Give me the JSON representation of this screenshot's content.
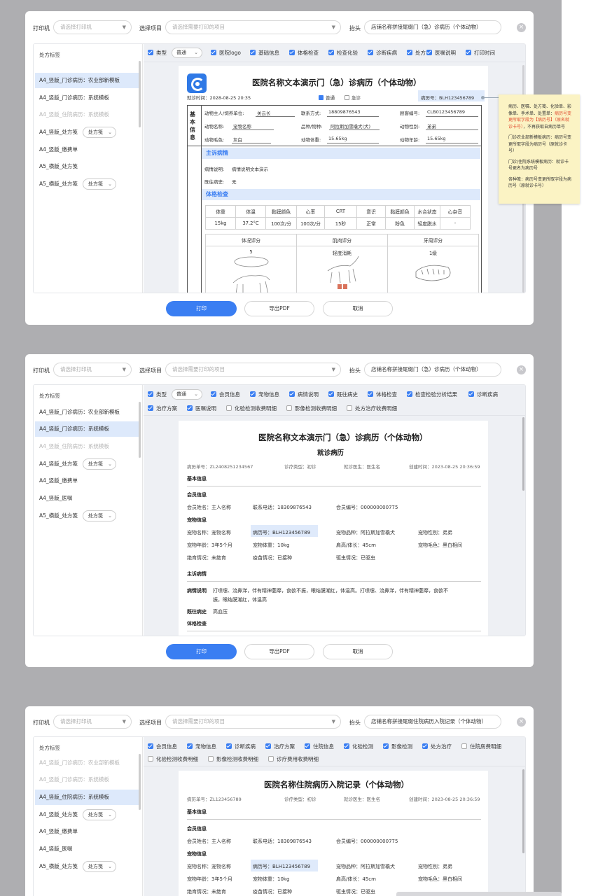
{
  "common": {
    "printer_label": "打印机",
    "printer_placeholder": "请选择打印机",
    "project_label": "选择项目",
    "project_placeholder": "请选择需要打印的项目",
    "header_label": "抬头",
    "side_title": "处方标签",
    "type_label": "类型",
    "type_value": "普通",
    "rx_value": "处方笺",
    "print_btn": "打印",
    "pdf_btn": "导出PDF",
    "cancel_btn": "取消",
    "close_icon": "×"
  },
  "panel1": {
    "header_value": "店铺名称拼接尾缀门（急）诊病历（个体动物）",
    "side_items": [
      "A4_竖版_门诊病历：农业部新模板",
      "A4_竖版_门诊病历：系统模板",
      "A4_竖版_住院病历：系统模板",
      "A4_竖版_处方笺",
      "A4_竖版_缴费单",
      "A5_横版_处方笺"
    ],
    "checks": [
      "医院logo",
      "基础信息",
      "体格检查",
      "检查化验",
      "诊断疾病",
      "处方",
      "医嘱说明",
      "打印时间"
    ],
    "doc": {
      "title": "医院名称文本演示门（急）诊病历（个体动物）",
      "visit_time": "就诊时间：2028-08-25 20:35",
      "normal": "普通",
      "emergency": "急诊",
      "record_no": "病历号：BLH123456789",
      "basic_label": "基本信息",
      "owner_label": "动物主人/饲养单位:",
      "owner": "关云长",
      "contact_label": "联系方式:",
      "contact": "18809876543",
      "client_label": "顾客编号:",
      "client": "CLB0123456789",
      "name_label": "动物名称:",
      "name": "宠物名称",
      "breed_label": "品种/物种:",
      "breed": "阿拉斯加雪橇犬(犬)",
      "sex_label": "动物性别:",
      "sex": "弟弟",
      "fur_label": "动物毛色:",
      "fur": "灰白",
      "weight_label": "动物体重:",
      "weight": "15.65kg",
      "age_label": "动物年龄:",
      "age": "15.65kg",
      "complaint_head": "主诉病情",
      "desc_label": "病情说明:",
      "desc": "病情说明文本演示",
      "history_label": "既往病史:",
      "history": "无",
      "exam_head": "体格检查",
      "exam_headers": [
        "体重",
        "体温",
        "黏膜颜色",
        "心率",
        "CRT",
        "意识",
        "黏膜颜色",
        "水合状态",
        "心杂音"
      ],
      "exam_values": [
        "15kg",
        "37.2°C",
        "100次/分",
        "100次/分",
        "15秒",
        "正常",
        "粉色",
        "轻度脱水",
        "-"
      ],
      "score_headers": [
        "体况评分",
        "肌肉评分",
        "牙周评分"
      ],
      "score_values": [
        "5",
        "轻度消耗",
        "1级"
      ]
    },
    "note": {
      "p1a": "病历、医嘱、处方笺、化验单、影像单、手术单、处置单：",
      "p1b": "病历号变更所取字段为【病历号】（原名就诊卡号）",
      "p1c": "，不再获取自病历单号",
      "p2": "门诊农业部新模板病历：病历号变更所取字段为病历号（原就诊卡号）",
      "p3": "门诊/住院系统模板病历：就诊卡号更名为病历号",
      "p4": "各种笺：病历号变更所取字段为病历号（原就诊卡号）"
    }
  },
  "panel2": {
    "header_value": "店铺名称拼接尾缀门（急）诊病历（个体动物）",
    "side_items": [
      "A4_竖版_门诊病历：农业部新模板",
      "A4_竖版_门诊病历：系统模板",
      "A4_竖版_住院病历：系统模板",
      "A4_竖版_处方笺",
      "A4_竖版_缴费单",
      "A4_竖版_医嘱",
      "A5_横版_处方笺"
    ],
    "checks_row1": [
      "会员信息",
      "宠物信息",
      "病情说明",
      "既往病史",
      "体格检查",
      "检查检验分析结果",
      "诊断疾病"
    ],
    "checks_row2_on": [
      "治疗方案",
      "医嘱说明"
    ],
    "checks_row2_off": [
      "化验检测收费明细",
      "影像检测收费明细",
      "处方治疗收费明细"
    ],
    "doc": {
      "title": "医院名称文本演示门（急）诊病历（个体动物）",
      "subtitle": "就诊病历",
      "record": "病历单号：ZL2408251234567",
      "visit_type": "诊疗类型：初诊",
      "doctor": "就诊医生：医生名",
      "created": "创建时间：2023-08-25 20:36:59",
      "basic": "基本信息",
      "member": "会员信息",
      "member_name": "会员姓名：主人名称",
      "phone": "联系电话：18309876543",
      "member_no": "会员编号：000000000775",
      "pet": "宠物信息",
      "pet_name": "宠物名称：宠物名称",
      "record_no": "病历号：BLH123456789",
      "breed": "宠物品种：阿拉斯加雪橇犬",
      "sex": "宠物性别：弟弟",
      "age": "宠物年龄：3年5个月",
      "weight": "宠物体重：10kg",
      "height": "肩高/体长：45cm",
      "fur": "宠物毛色：黑白相间",
      "sterile": "绝育情况：未绝育",
      "vaccine": "疫苗情况：已接种",
      "deworm": "驱虫情况：已驱虫",
      "complaint": "主诉病情",
      "desc_label": "病情说明",
      "desc1": "打喷嚏、流鼻涕，伴有精神萎靡，食欲不振，眼结膜潮红，体温高。打喷嚏、流鼻涕，伴有精神萎靡，食欲不",
      "desc2": "振，眼结膜潮红，体温高",
      "history_label": "既往病史",
      "history": "高血压",
      "exam": "体格检查"
    }
  },
  "panel3": {
    "header_value": "店铺名称拼接尾缀住院病历入院记录（个体动物）",
    "side_items": [
      "A4_竖版_门诊病历：农业部新模板",
      "A4_竖版_门诊病历：系统模板",
      "A4_竖版_住院病历：系统模板",
      "A4_竖版_处方笺",
      "A4_竖版_缴费单",
      "A4_竖版_医嘱",
      "A5_横版_处方笺"
    ],
    "checks_row1_on": [
      "会员信息",
      "宠物信息",
      "诊断疾病",
      "治疗方案",
      "住院信息",
      "化验检测",
      "影像检测",
      "处方治疗"
    ],
    "checks_row1_off": [
      "住院房费明细"
    ],
    "checks_row2_off": [
      "化验检测收费明细",
      "影像检测收费明细",
      "诊疗费用收费明细"
    ],
    "doc": {
      "title": "医院名称住院病历入院记录（个体动物）",
      "record": "病历单号：ZL123456789",
      "visit_type": "诊疗类型：初诊",
      "doctor": "就诊医生：医生名",
      "created": "创建时间：2023-08-25 20:36:59",
      "basic": "基本信息",
      "member": "会员信息",
      "member_name": "会员姓名：主人名称",
      "phone": "联系电话：18309876543",
      "member_no": "会员编号：000000000775",
      "pet": "宠物信息",
      "pet_name": "宠物名称：宠物名称",
      "record_no": "病历号：BLH123456789",
      "breed": "宠物品种：阿拉斯加雪橇犬",
      "sex": "宠物性别：弟弟",
      "age": "宠物年龄：3年5个月",
      "weight": "宠物体重：10kg",
      "height": "肩高/体长：45cm",
      "fur": "宠物毛色：黑白相间",
      "sterile": "绝育情况：未绝育",
      "vaccine": "疫苗情况：已接种",
      "deworm": "驱虫情况：已驱虫"
    }
  }
}
